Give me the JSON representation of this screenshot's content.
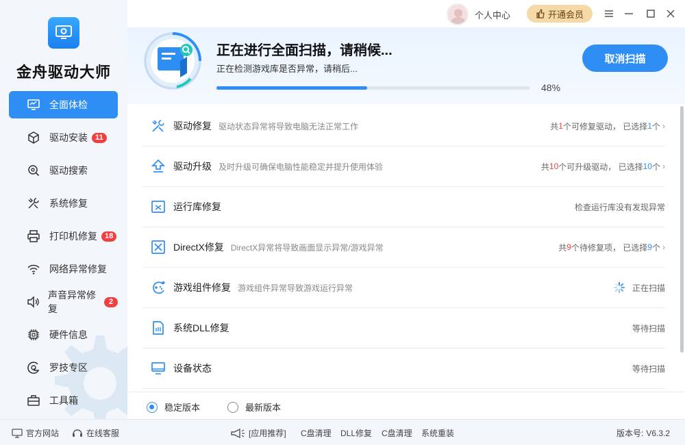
{
  "app": {
    "title": "金舟驱动大师"
  },
  "topbar": {
    "user_center": "个人中心",
    "vip": "开通会员"
  },
  "sidebar": {
    "items": [
      {
        "label": "全面体检",
        "badge": ""
      },
      {
        "label": "驱动安装",
        "badge": "11"
      },
      {
        "label": "驱动搜索",
        "badge": ""
      },
      {
        "label": "系统修复",
        "badge": ""
      },
      {
        "label": "打印机修复",
        "badge": "18"
      },
      {
        "label": "网络异常修复",
        "badge": ""
      },
      {
        "label": "声音异常修复",
        "badge": "2"
      },
      {
        "label": "硬件信息",
        "badge": ""
      },
      {
        "label": "罗技专区",
        "badge": ""
      },
      {
        "label": "工具箱",
        "badge": ""
      }
    ]
  },
  "scan": {
    "title": "正在进行全面扫描，请稍候...",
    "subtitle": "正在检测游戏库是否异常，请稍后...",
    "progress_percent": 48,
    "percent_label": "48%",
    "cancel_label": "取消扫描"
  },
  "list": {
    "driver_repair": {
      "title": "驱动修复",
      "desc": "驱动状态异常将导致电脑无法正常工作",
      "r1": "共",
      "n1": "1",
      "r2": "个可修复驱动， 已选择",
      "n2": "1",
      "r3": "个"
    },
    "driver_upgrade": {
      "title": "驱动升级",
      "desc": "及时升级可确保电脑性能稳定并提升使用体验",
      "r1": "共",
      "n1": "10",
      "r2": "个可升级驱动， 已选择",
      "n2": "10",
      "r3": "个"
    },
    "runtime_repair": {
      "title": "运行库修复",
      "status": "检查运行库没有发现异常"
    },
    "directx_repair": {
      "title": "DirectX修复",
      "desc": "DirectX异常将导致画面显示异常/游戏异常",
      "r1": "共",
      "n1": "9",
      "r2": "个待修复项， 已选择",
      "n2": "9",
      "r3": "个"
    },
    "game_component": {
      "title": "游戏组件修复",
      "desc": "游戏组件异常导致游戏运行异常",
      "status": "正在扫描"
    },
    "system_dll": {
      "title": "系统DLL修复",
      "status": "等待扫描"
    },
    "device_status": {
      "title": "设备状态",
      "status": "等待扫描"
    }
  },
  "version": {
    "stable": "稳定版本",
    "latest": "最新版本"
  },
  "footer": {
    "website": "官方网站",
    "service": "在线客服",
    "recommend": "[应用推荐]",
    "links": [
      "C盘清理",
      "DLL修复",
      "C盘清理",
      "系统重装"
    ],
    "version_label": "版本号:",
    "version_value": "V6.3.2"
  },
  "colors": {
    "accent": "#2f8ef4",
    "badge": "#f04141",
    "vip": "#f5d9a6"
  }
}
